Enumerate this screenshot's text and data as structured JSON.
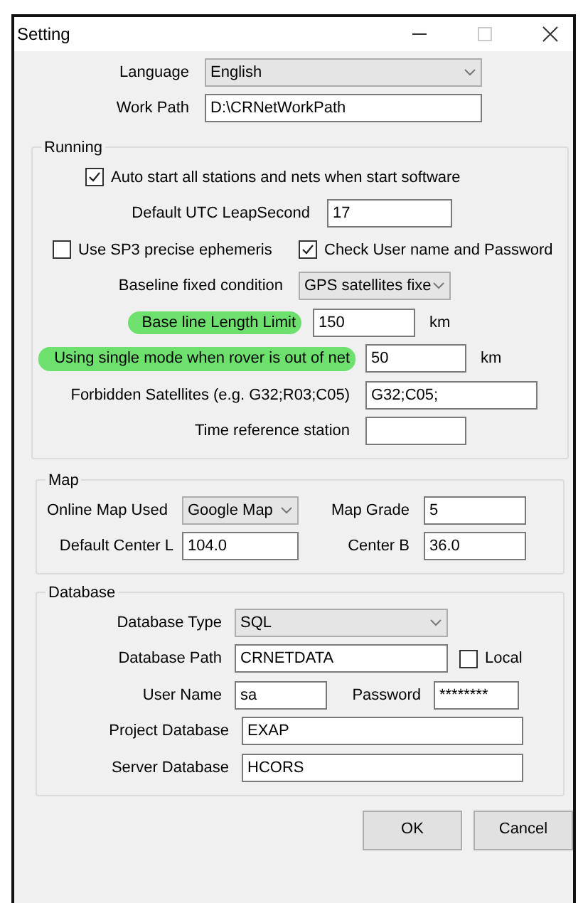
{
  "window": {
    "title": "Setting"
  },
  "general": [
    {
      "kind": "select",
      "label": "Language",
      "value": "English"
    },
    {
      "kind": "field",
      "label": "Work Path",
      "value": "D:\\CRNetWorkPath"
    }
  ],
  "running": {
    "title": "Running",
    "rows": [
      {
        "items": [
          {
            "kind": "checkbox",
            "label": "Auto start all stations and nets when start software",
            "checked": true
          }
        ]
      },
      {
        "items": [
          {
            "kind": "field",
            "label": "Default UTC LeapSecond",
            "value": "17"
          }
        ]
      },
      {
        "items": [
          {
            "kind": "checkbox",
            "label": "Use SP3 precise ephemeris",
            "checked": false
          },
          {
            "kind": "checkbox",
            "label": "Check User name and Password",
            "checked": true
          }
        ]
      },
      {
        "items": [
          {
            "kind": "select",
            "label": "Baseline fixed condition",
            "value": "GPS satellites fixe"
          }
        ]
      },
      {
        "items": [
          {
            "kind": "field",
            "label": "Base line Length Limit",
            "value": "150",
            "unit": "km",
            "highlighted": true
          }
        ]
      },
      {
        "items": [
          {
            "kind": "field",
            "label": "Using single mode when rover is out of net",
            "value": "50",
            "unit": "km",
            "highlighted": true
          }
        ]
      },
      {
        "items": [
          {
            "kind": "field",
            "label": "Forbidden Satellites (e.g. G32;R03;C05)",
            "value": "G32;C05;",
            "highlighted": false
          }
        ]
      },
      {
        "items": [
          {
            "kind": "field",
            "label": "Time reference station"
          }
        ]
      }
    ]
  },
  "map": {
    "title": "Map",
    "rows": [
      {
        "items": [
          {
            "kind": "select",
            "label": "Online Map Used",
            "value": "Google Map"
          },
          {
            "kind": "field",
            "label": "Map Grade",
            "value": "5"
          }
        ]
      },
      {
        "items": [
          {
            "kind": "field",
            "label": "Default Center L",
            "value": "104.0"
          },
          {
            "kind": "field",
            "label": "Center B",
            "value": "36.0"
          }
        ]
      }
    ]
  },
  "database": {
    "title": "Database",
    "rows": [
      {
        "items": [
          {
            "kind": "select",
            "label": "Database Type",
            "value": "SQL"
          }
        ]
      },
      {
        "items": [
          {
            "kind": "field",
            "label": "Database Path",
            "value": "CRNETDATA"
          },
          {
            "kind": "checkbox",
            "label": "Local",
            "checked": false
          }
        ]
      },
      {
        "items": [
          {
            "kind": "field",
            "label": "User Name",
            "value": "sa"
          },
          {
            "kind": "field",
            "label": "Password",
            "value": "********"
          }
        ]
      },
      {
        "items": [
          {
            "kind": "field",
            "label": "Project Database",
            "value": "EXAP"
          }
        ]
      },
      {
        "items": [
          {
            "kind": "field",
            "label": "Server Database",
            "value": "HCORS"
          }
        ]
      }
    ]
  },
  "buttons": [
    "OK",
    "Cancel"
  ]
}
